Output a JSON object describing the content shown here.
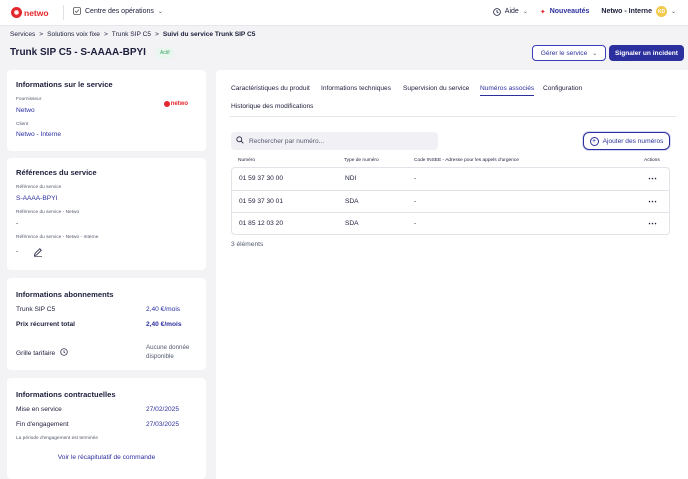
{
  "topbar": {
    "logo_text": "netwo",
    "ops_label": "Centre des opérations",
    "help_label": "Aide",
    "news_label": "Nouveautés",
    "account_label": "Netwo - Interne",
    "avatar_initials": "KD",
    "colors": {
      "brand_red": "#e4262d",
      "primary": "#2c2f9e"
    }
  },
  "breadcrumb": [
    "Services",
    "Solutions voix fixe",
    "Trunk SIP C5",
    "Suivi du service Trunk SIP C5"
  ],
  "header": {
    "title": "Trunk SIP C5 - S-AAAA-BPYI",
    "status": "Actif",
    "manage_label": "Gérer le service",
    "report_label": "Signaler un incident"
  },
  "service_info": {
    "title": "Informations sur le service",
    "provider_label": "Fournisseur",
    "provider_value": "Netwo",
    "provider_logo": "netwo",
    "client_label": "Client",
    "client_value": "Netwo - Interne"
  },
  "references": {
    "title": "Références du service",
    "ref_label": "Référence du service",
    "ref_value": "S-AAAA-BPYI",
    "ref_netwo_label": "Référence du service - Netwo",
    "ref_netwo_value": "-",
    "ref_internal_label": "Référence du service - Netwo - Interne",
    "ref_internal_value": "-"
  },
  "subscription": {
    "title": "Informations abonnements",
    "line_label": "Trunk SIP C5",
    "line_value": "2,40 €/mois",
    "total_label": "Prix récurrent total",
    "total_value": "2,40 €/mois",
    "grid_label": "Grille tarifaire",
    "grid_value": "Aucune donnée disponible"
  },
  "contract": {
    "title": "Informations contractuelles",
    "start_label": "Mise en service",
    "start_value": "27/02/2025",
    "end_label": "Fin d'engagement",
    "end_value": "27/03/2025",
    "note": "La période d'engagement est terminée",
    "summary_link": "Voir le récapitulatif de commande"
  },
  "tabs": [
    "Caractéristiques du produit",
    "Informations techniques",
    "Supervision du service",
    "Numéros associés",
    "Configuration",
    "Historique des modifications"
  ],
  "numbers": {
    "search_placeholder": "Rechercher par numéro...",
    "add_label": "Ajouter des numéros",
    "columns": [
      "Numéro",
      "Type de numéro",
      "Code INSEE - Adresse pour les appels d'urgence",
      "Actions"
    ],
    "rows": [
      {
        "number": "01 59 37 30 00",
        "type": "NDI",
        "insee": "-"
      },
      {
        "number": "01 59 37 30 01",
        "type": "SDA",
        "insee": "-"
      },
      {
        "number": "01 85 12 03 20",
        "type": "SDA",
        "insee": "-"
      }
    ],
    "count": "3 éléments"
  }
}
